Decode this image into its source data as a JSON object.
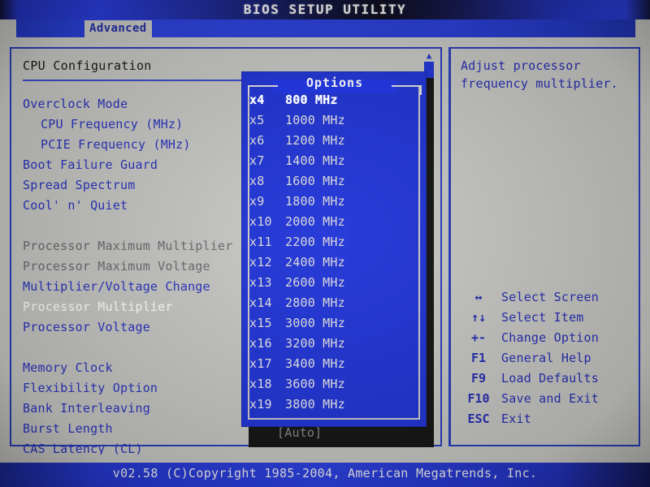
{
  "titlebar": {
    "title": "BIOS SETUP UTILITY"
  },
  "tabs": [
    {
      "id": "advanced",
      "label": "Advanced",
      "active": true
    }
  ],
  "main": {
    "section_title": "CPU Configuration",
    "settings": [
      {
        "label": "Overclock Mode",
        "style": "link"
      },
      {
        "label": "CPU Frequency (MHz)",
        "style": "sub"
      },
      {
        "label": "PCIE Frequency (MHz)",
        "style": "sub"
      },
      {
        "label": "Boot Failure Guard",
        "style": "link"
      },
      {
        "label": "Spread Spectrum",
        "style": "link"
      },
      {
        "label": "Cool' n' Quiet",
        "style": "link"
      },
      {
        "label": "",
        "style": "gap"
      },
      {
        "label": "Processor Maximum Multiplier",
        "style": "gray"
      },
      {
        "label": "Processor Maximum Voltage",
        "style": "gray"
      },
      {
        "label": "Multiplier/Voltage Change",
        "style": "link"
      },
      {
        "label": "Processor Multiplier",
        "style": "sel"
      },
      {
        "label": "Processor Voltage",
        "style": "link"
      },
      {
        "label": "",
        "style": "gap"
      },
      {
        "label": "Memory Clock",
        "style": "link"
      },
      {
        "label": "Flexibility Option",
        "style": "link"
      },
      {
        "label": "Bank Interleaving",
        "style": "link"
      },
      {
        "label": "Burst Length",
        "style": "link"
      },
      {
        "label": "CAS Latency (CL)",
        "style": "link"
      }
    ]
  },
  "scrollbar": {
    "up_glyph": "▲",
    "down_glyph": "▼"
  },
  "dialog": {
    "title": "Options",
    "current_value": "[Auto]",
    "options": [
      {
        "multiplier": "x4",
        "frequency": "800 MHz",
        "selected": true
      },
      {
        "multiplier": "x5",
        "frequency": "1000 MHz",
        "selected": false
      },
      {
        "multiplier": "x6",
        "frequency": "1200 MHz",
        "selected": false
      },
      {
        "multiplier": "x7",
        "frequency": "1400 MHz",
        "selected": false
      },
      {
        "multiplier": "x8",
        "frequency": "1600 MHz",
        "selected": false
      },
      {
        "multiplier": "x9",
        "frequency": "1800 MHz",
        "selected": false
      },
      {
        "multiplier": "x10",
        "frequency": "2000 MHz",
        "selected": false
      },
      {
        "multiplier": "x11",
        "frequency": "2200 MHz",
        "selected": false
      },
      {
        "multiplier": "x12",
        "frequency": "2400 MHz",
        "selected": false
      },
      {
        "multiplier": "x13",
        "frequency": "2600 MHz",
        "selected": false
      },
      {
        "multiplier": "x14",
        "frequency": "2800 MHz",
        "selected": false
      },
      {
        "multiplier": "x15",
        "frequency": "3000 MHz",
        "selected": false
      },
      {
        "multiplier": "x16",
        "frequency": "3200 MHz",
        "selected": false
      },
      {
        "multiplier": "x17",
        "frequency": "3400 MHz",
        "selected": false
      },
      {
        "multiplier": "x18",
        "frequency": "3600 MHz",
        "selected": false
      },
      {
        "multiplier": "x19",
        "frequency": "3800 MHz",
        "selected": false
      }
    ]
  },
  "help": {
    "text_line1": "Adjust processor",
    "text_line2": "frequency multiplier.",
    "legend": [
      {
        "key": "↔",
        "action": "Select Screen"
      },
      {
        "key": "↑↓",
        "action": "Select Item"
      },
      {
        "key": "+-",
        "action": "Change Option"
      },
      {
        "key": "F1",
        "action": "General Help"
      },
      {
        "key": "F9",
        "action": "Load Defaults"
      },
      {
        "key": "F10",
        "action": "Save and Exit"
      },
      {
        "key": "ESC",
        "action": "Exit"
      }
    ]
  },
  "footer": {
    "copyright": "v02.58 (C)Copyright 1985-2004, American Megatrends, Inc."
  },
  "colors": {
    "background": "#c9c9c6",
    "accent_blue": "#2236d8",
    "text_blue": "#2730b4",
    "disabled_gray": "#6d6d72",
    "selected_white": "#ffffff",
    "shadow": "#161616"
  }
}
